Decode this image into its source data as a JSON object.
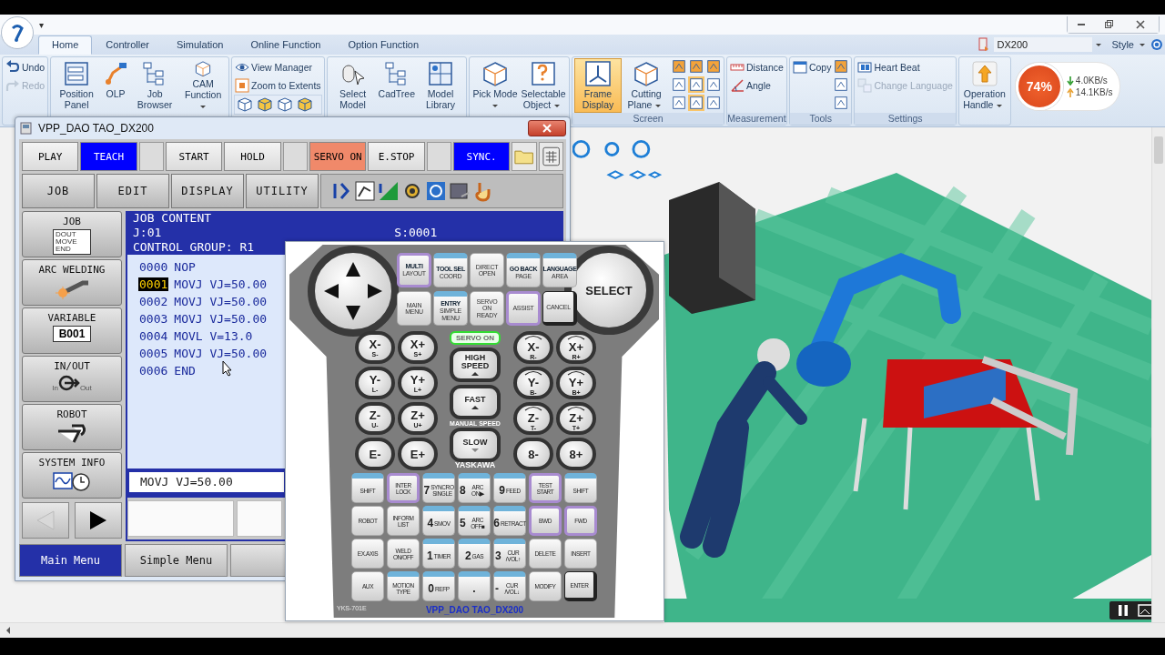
{
  "app": {
    "quick_access_caret": "▾",
    "tabs": [
      {
        "label": "Home",
        "selected": true
      },
      {
        "label": "Controller",
        "selected": false
      },
      {
        "label": "Simulation",
        "selected": false
      },
      {
        "label": "Online Function",
        "selected": false
      },
      {
        "label": "Option Function",
        "selected": false
      }
    ],
    "controller": "DX200",
    "style": "Style",
    "ribbon": {
      "groups": [
        {
          "items": [
            {
              "kind": "small",
              "label": "Undo",
              "disabled": false
            },
            {
              "kind": "small",
              "label": "Redo",
              "disabled": true
            }
          ]
        },
        {
          "items": [
            {
              "kind": "large",
              "label": "Position Panel",
              "dropdown": false,
              "on": false
            },
            {
              "kind": "large",
              "label": "OLP",
              "dropdown": false,
              "on": false
            },
            {
              "kind": "large",
              "label": "Job Browser",
              "dropdown": false,
              "on": false
            },
            {
              "kind": "large",
              "label": "CAM Function",
              "dropdown": true,
              "on": false
            }
          ]
        },
        {
          "items": [
            {
              "kind": "small",
              "label": "View Manager",
              "disabled": false
            },
            {
              "kind": "small",
              "label": "Zoom to Extents",
              "disabled": false
            }
          ]
        },
        {
          "items": [
            {
              "kind": "large",
              "label": "Select Model",
              "dropdown": false,
              "on": false
            },
            {
              "kind": "large",
              "label": "CadTree",
              "dropdown": false,
              "on": false
            },
            {
              "kind": "large",
              "label": "Model Library",
              "dropdown": false,
              "on": false
            }
          ]
        },
        {
          "items": [
            {
              "kind": "large",
              "label": "Pick Mode",
              "dropdown": true,
              "on": false
            },
            {
              "kind": "large",
              "label": "Selectable Object",
              "dropdown": true,
              "on": false
            }
          ]
        },
        {
          "label": "Screen",
          "items": [
            {
              "kind": "large",
              "label": "Frame Display",
              "dropdown": false,
              "on": true
            },
            {
              "kind": "large",
              "label": "Cutting Plane",
              "dropdown": true,
              "on": false
            }
          ]
        },
        {
          "label": "Measurement",
          "items": [
            {
              "kind": "small",
              "label": "Distance",
              "disabled": false
            },
            {
              "kind": "small",
              "label": "Angle",
              "disabled": false
            }
          ]
        },
        {
          "label": "Tools",
          "items": [
            {
              "kind": "small",
              "label": "Copy",
              "disabled": false
            }
          ]
        },
        {
          "label": "Settings",
          "items": [
            {
              "kind": "small",
              "label": "Heart Beat",
              "disabled": false
            },
            {
              "kind": "small",
              "label": "Change Language",
              "disabled": true
            }
          ]
        },
        {
          "items": [
            {
              "kind": "large",
              "label": "Operation Handle",
              "dropdown": true,
              "on": false
            }
          ]
        }
      ]
    },
    "net_meter": {
      "percent": "74%",
      "down": "4.0KB/s",
      "up": "14.1KB/s"
    }
  },
  "pendant": {
    "title": "VPP_DAO TAO_DX200",
    "mode_buttons": [
      {
        "label": "PLAY",
        "on": false
      },
      {
        "label": "TEACH",
        "on": true,
        "color": "#0000ff"
      },
      {
        "label": "START",
        "on": false
      },
      {
        "label": "HOLD",
        "on": false
      },
      {
        "label": "SERVO ON",
        "on": true,
        "color": "#f0896a"
      },
      {
        "label": "E.STOP",
        "on": false
      },
      {
        "label": "SYNC.",
        "on": true,
        "color": "#0000ff"
      }
    ],
    "menu_buttons": [
      "JOB",
      "EDIT",
      "DISPLAY",
      "UTILITY"
    ],
    "side_menu": [
      {
        "kind": "job",
        "label": "JOB",
        "icon_text": "DOUT MOVE END"
      },
      {
        "kind": "arc",
        "label": "ARC WELDING"
      },
      {
        "kind": "variable",
        "label": "VARIABLE",
        "icon_text": "B001"
      },
      {
        "kind": "inout",
        "label": "IN/OUT",
        "icon_text": "In",
        "icon_text_2": "Out"
      },
      {
        "kind": "robot",
        "label": "ROBOT"
      },
      {
        "kind": "sysinfo",
        "label": "SYSTEM INFO"
      }
    ],
    "job": {
      "heading": "JOB CONTENT",
      "job_no": "J:01",
      "step_no": "S:0001",
      "control_group": "CONTROL GROUP: R1",
      "lines": [
        {
          "no": "0000",
          "text": "NOP",
          "selected": false
        },
        {
          "no": "0001",
          "text": "MOVJ VJ=50.00",
          "selected": true
        },
        {
          "no": "0002",
          "text": "MOVJ VJ=50.00",
          "selected": false
        },
        {
          "no": "0003",
          "text": "MOVJ VJ=50.00",
          "selected": false
        },
        {
          "no": "0004",
          "text": "MOVL V=13.0",
          "selected": false
        },
        {
          "no": "0005",
          "text": "MOVJ VJ=50.00",
          "selected": false
        },
        {
          "no": "0006",
          "text": "END",
          "selected": false
        }
      ],
      "input_line": "MOVJ VJ=50.00"
    },
    "bottom_tabs": [
      {
        "label": "Main Menu",
        "selected": true
      },
      {
        "label": "Simple Menu",
        "selected": false
      }
    ]
  },
  "keypad": {
    "select": "SELECT",
    "function_keys": [
      {
        "kind": "purple",
        "cap": "MULTI",
        "label": "LAYOUT"
      },
      {
        "kind": "blue",
        "cap": "TOOL SEL",
        "label": "COORD"
      },
      {
        "kind": "plain",
        "label": "DIRECT OPEN"
      },
      {
        "kind": "blue",
        "cap": "GO BACK",
        "label": "PAGE"
      },
      {
        "kind": "blue",
        "cap": "LANGUAGE",
        "label": "AREA"
      },
      {
        "kind": "plain",
        "label": "MAIN MENU"
      },
      {
        "kind": "blue",
        "cap": "ENTRY",
        "label": "SIMPLE MENU"
      },
      {
        "kind": "plain",
        "label": "SERVO ON READY"
      },
      {
        "kind": "purple",
        "label": "ASSIST"
      },
      {
        "kind": "dark",
        "label": "CANCEL"
      }
    ],
    "left_axis": [
      {
        "main": "X-",
        "sub": "S-"
      },
      {
        "main": "X+",
        "sub": "S+"
      },
      {
        "main": "Y-",
        "sub": "L-"
      },
      {
        "main": "Y+",
        "sub": "L+"
      },
      {
        "main": "Z-",
        "sub": "U-"
      },
      {
        "main": "Z+",
        "sub": "U+"
      },
      {
        "main": "E-"
      },
      {
        "main": "E+"
      }
    ],
    "servo_lamp": {
      "label": "SERVO ON",
      "on": true
    },
    "speed_keys": [
      "HIGH SPEED",
      "FAST",
      "SLOW"
    ],
    "speed_caption": "MANUAL SPEED",
    "right_axis": [
      {
        "main": "X-",
        "sub": "R-",
        "kind": "rotary"
      },
      {
        "main": "X+",
        "sub": "R+",
        "kind": "rotary"
      },
      {
        "main": "Y-",
        "sub": "B-",
        "kind": "rotary"
      },
      {
        "main": "Y+",
        "sub": "B+",
        "kind": "rotary"
      },
      {
        "main": "Z-",
        "sub": "T-",
        "kind": "rotary"
      },
      {
        "main": "Z+",
        "sub": "T+",
        "kind": "rotary"
      },
      {
        "main": "8-",
        "kind": "linear"
      },
      {
        "main": "8+",
        "kind": "linear"
      }
    ],
    "brand": "YASKAWA",
    "keys": [
      {
        "kind": "blue",
        "label": "SHIFT"
      },
      {
        "kind": "purple",
        "label": "INTER LOCK"
      },
      {
        "kind": "blue",
        "num": "7",
        "label": "SYNCRO SINGLE"
      },
      {
        "kind": "blue",
        "num": "8",
        "label": "ARC ON▶"
      },
      {
        "kind": "blue",
        "num": "9",
        "label": "FEED"
      },
      {
        "kind": "purple",
        "label": "TEST START"
      },
      {
        "kind": "blue",
        "label": "SHIFT"
      },
      {
        "kind": "plain",
        "label": "ROBOT"
      },
      {
        "kind": "plain",
        "label": "INFORM LIST"
      },
      {
        "kind": "blue",
        "num": "4",
        "label": "SMOV"
      },
      {
        "kind": "blue",
        "num": "5",
        "label": "ARC OFF■"
      },
      {
        "kind": "blue",
        "num": "6",
        "label": "RETRACT"
      },
      {
        "kind": "purple",
        "label": "BWD"
      },
      {
        "kind": "purple",
        "label": "FWD"
      },
      {
        "kind": "plain",
        "label": "EX.AXIS"
      },
      {
        "kind": "plain",
        "label": "WELD ON/OFF"
      },
      {
        "kind": "blue",
        "num": "1",
        "label": "TIMER"
      },
      {
        "kind": "blue",
        "num": "2",
        "label": "GAS"
      },
      {
        "kind": "blue",
        "num": "3",
        "label": "CUR /VOL↑"
      },
      {
        "kind": "plain",
        "label": "DELETE"
      },
      {
        "kind": "plain",
        "label": "INSERT"
      },
      {
        "kind": "plain",
        "label": "AUX"
      },
      {
        "kind": "blue",
        "label": "MOTION TYPE"
      },
      {
        "kind": "blue",
        "num": "0",
        "label": "REFP"
      },
      {
        "kind": "blue",
        "num": "."
      },
      {
        "kind": "blue",
        "num": "-",
        "label": "CUR /VOL↓"
      },
      {
        "kind": "plain",
        "label": "MODIFY"
      },
      {
        "kind": "dark",
        "label": "ENTER"
      }
    ],
    "model": "YKS-701E",
    "caption": "VPP_DAO TAO_DX200"
  }
}
